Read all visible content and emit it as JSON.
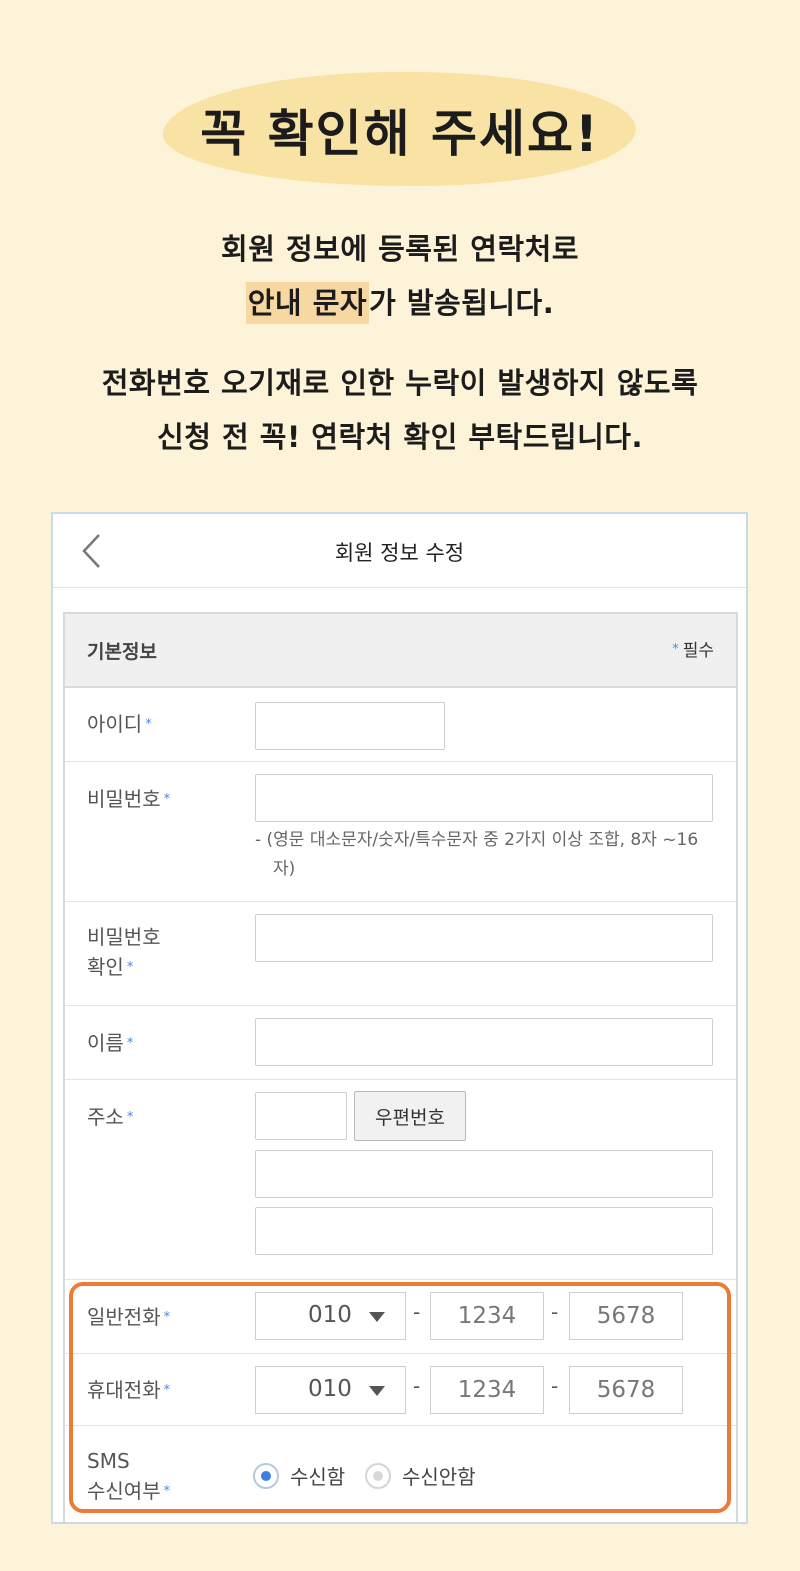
{
  "header": {
    "title": "꼭 확인해 주세요!",
    "line1": "회원 정보에 등록된 연락처로",
    "line2_highlight": "안내 문자",
    "line2_rest": "가 발송됩니다.",
    "line3": "전화번호 오기재로 인한 누락이 발생하지 않도록",
    "line4": "신청 전 꼭! 연락처 확인 부탁드립니다."
  },
  "screen": {
    "title": "회원 정보 수정",
    "section_title": "기본정보",
    "required_star": "*",
    "required_label": "필수",
    "fields": {
      "id_label": "아이디",
      "password_label": "비밀번호",
      "password_hint": "- (영문 대소문자/숫자/특수문자 중 2가지 이상 조합, 8자 ~16자)",
      "password_confirm_label_1": "비밀번호",
      "password_confirm_label_2": "확인",
      "name_label": "이름",
      "address_label": "주소",
      "zip_button": "우편번호",
      "landline_label": "일반전화",
      "mobile_label": "휴대전화",
      "sms_label_1": "SMS",
      "sms_label_2": "수신여부"
    },
    "landline": {
      "prefix": "010",
      "middle": "1234",
      "last": "5678",
      "dash": "-"
    },
    "mobile": {
      "prefix": "010",
      "middle": "1234",
      "last": "5678",
      "dash": "-"
    },
    "sms_options": {
      "receive": "수신함",
      "reject": "수신안함",
      "selected": "receive"
    },
    "colors": {
      "highlight_border": "#ee7a3a",
      "required_star": "#4a86e0",
      "background": "#fdf3d9"
    }
  }
}
